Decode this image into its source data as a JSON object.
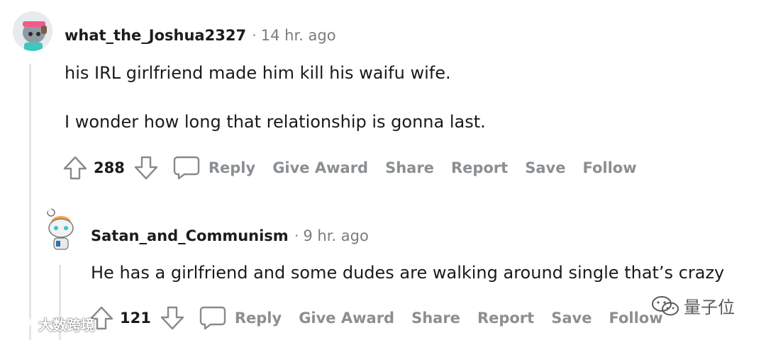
{
  "comments": [
    {
      "username": "what_the_Joshua2327",
      "separator": "·",
      "time": "14 hr. ago",
      "body": [
        "his IRL girlfriend made him kill his waifu wife.",
        "I wonder how long that relationship is gonna last."
      ],
      "score": "288",
      "actions": {
        "reply": "Reply",
        "award": "Give Award",
        "share": "Share",
        "report": "Report",
        "save": "Save",
        "follow": "Follow"
      }
    },
    {
      "username": "Satan_and_Communism",
      "separator": "·",
      "time": "9 hr. ago",
      "body": [
        "He has a girlfriend and some dudes are walking around single that’s crazy"
      ],
      "score": "121",
      "actions": {
        "reply": "Reply",
        "award": "Give Award",
        "share": "Share",
        "report": "Report",
        "save": "Save",
        "follow": "Follow"
      }
    }
  ],
  "watermarks": {
    "left": "大数跨境",
    "right": "量子位"
  },
  "icons": [
    "upvote-icon",
    "downvote-icon",
    "comment-icon",
    "wechat-icon"
  ],
  "colors": {
    "muted": "#8b8f92",
    "text": "#1a1a1b",
    "thread_line": "#e3e6e8"
  }
}
